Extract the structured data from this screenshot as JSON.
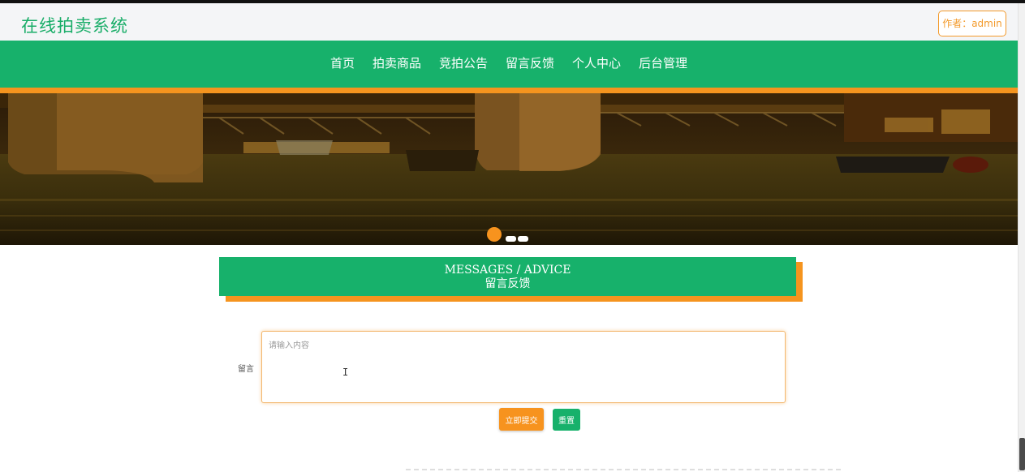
{
  "header": {
    "site_title": "在线拍卖系统",
    "author_label": "作者：admin"
  },
  "nav": {
    "items": [
      {
        "label": "首页"
      },
      {
        "label": "拍卖商品"
      },
      {
        "label": "竞拍公告"
      },
      {
        "label": "留言反馈"
      },
      {
        "label": "个人中心"
      },
      {
        "label": "后台管理"
      }
    ]
  },
  "banner": {
    "slide_count": 3,
    "active_slide": 1,
    "image": "bridge-over-river-night-photo"
  },
  "section": {
    "title_en": "MESSAGES / ADVICE",
    "title_cn": "留言反馈"
  },
  "form": {
    "message_label": "留言",
    "message_placeholder": "请输入内容",
    "message_value": "",
    "submit_label": "立即提交",
    "reset_label": "重置"
  },
  "colors": {
    "brand_green": "#17b16b",
    "accent_orange": "#f5941e",
    "title_green": "#19ad68"
  }
}
